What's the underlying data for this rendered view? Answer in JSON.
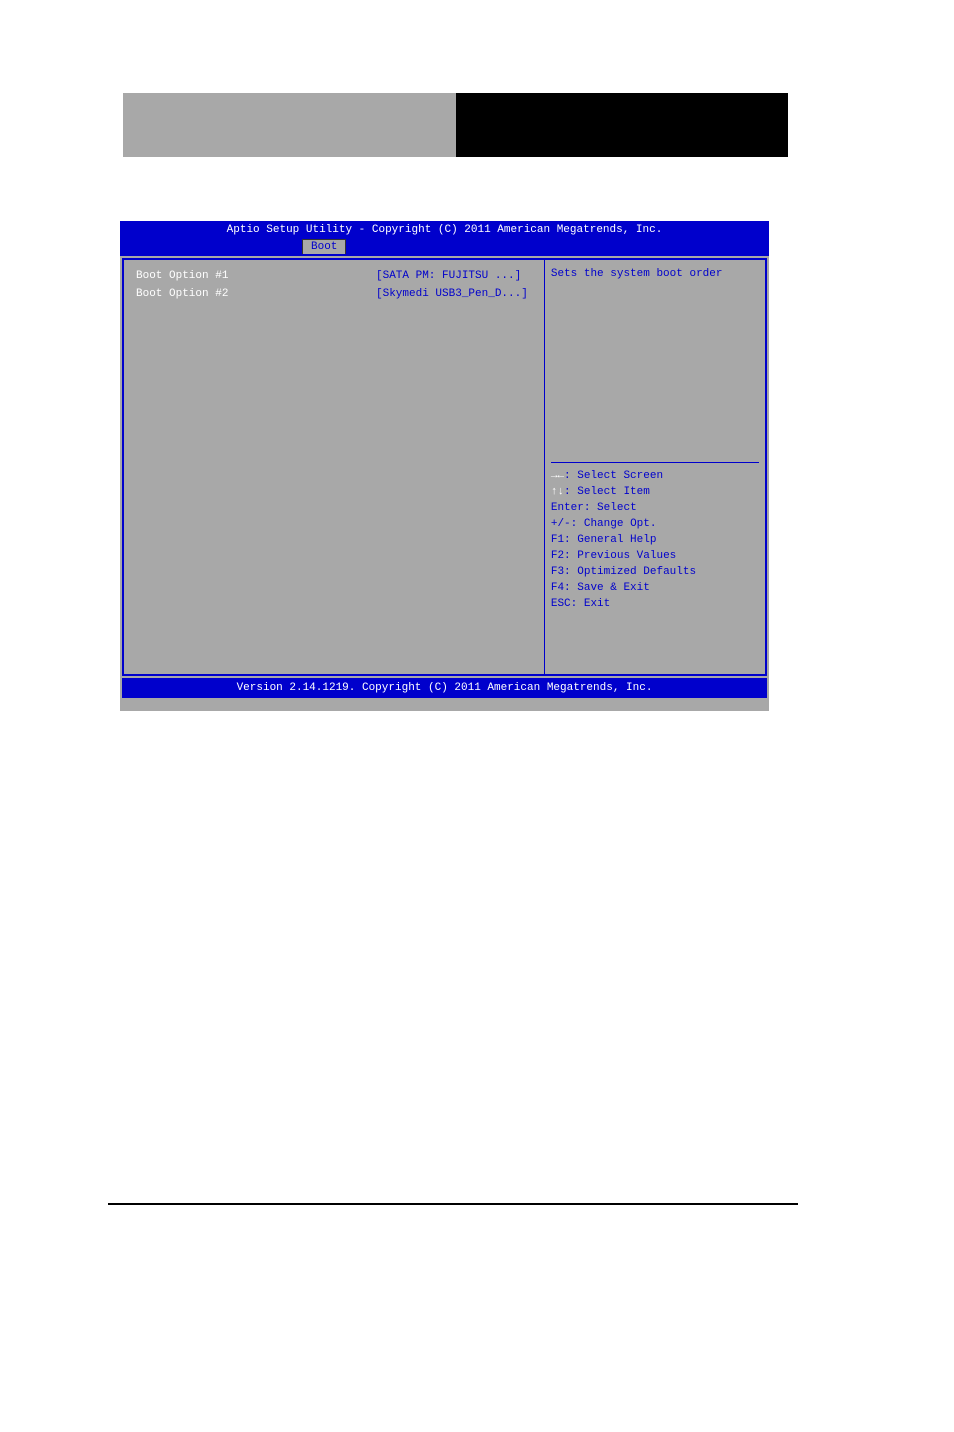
{
  "bios": {
    "title": "Aptio Setup Utility - Copyright (C) 2011 American Megatrends, Inc.",
    "tab": "Boot",
    "options": [
      {
        "label": "Boot Option #1",
        "value": "[SATA  PM: FUJITSU ...]"
      },
      {
        "label": "Boot Option #2",
        "value": "[Skymedi USB3_Pen_D...]"
      }
    ],
    "help_description": "Sets the system boot order",
    "keys": [
      {
        "k": "→←",
        "desc": ": Select Screen"
      },
      {
        "k": "↑↓",
        "desc": ": Select Item"
      },
      {
        "k": "Enter",
        "desc": ": Select"
      },
      {
        "k": "+/-",
        "desc": ": Change Opt."
      },
      {
        "k": "F1",
        "desc": ": General Help"
      },
      {
        "k": "F2",
        "desc": ": Previous Values"
      },
      {
        "k": "F3",
        "desc": ": Optimized Defaults"
      },
      {
        "k": "F4",
        "desc": ": Save & Exit"
      },
      {
        "k": "ESC",
        "desc": ": Exit"
      }
    ],
    "footer": "Version 2.14.1219. Copyright (C) 2011 American Megatrends, Inc."
  }
}
